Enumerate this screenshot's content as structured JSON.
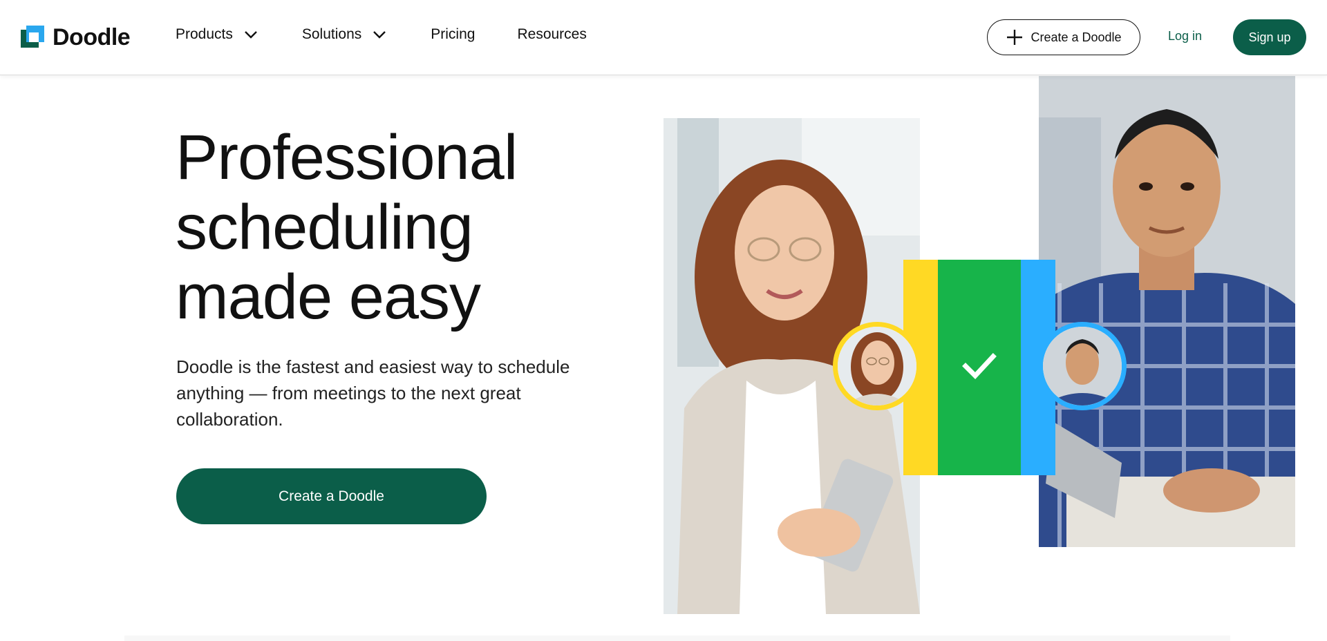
{
  "header": {
    "logo_text": "Doodle",
    "nav": {
      "products": "Products",
      "solutions": "Solutions",
      "pricing": "Pricing",
      "resources": "Resources"
    },
    "create_button": "Create a Doodle",
    "login": "Log in",
    "signup": "Sign up"
  },
  "hero": {
    "title_line1": "Professional",
    "title_line2": "scheduling",
    "title_line3": "made easy",
    "subtitle": "Doodle is the fastest and easiest way to schedule anything — from meetings to the next great collaboration.",
    "cta": "Create a Doodle"
  },
  "icons": {
    "logo": "doodle-logo-icon",
    "chevron": "chevron-down-icon",
    "plus": "plus-icon",
    "check": "check-icon"
  },
  "colors": {
    "brand_green": "#0b5e49",
    "logo_blue": "#2aa7ee",
    "accent_yellow": "#ffd924",
    "accent_green": "#17b44a",
    "accent_blue": "#2aaeff"
  }
}
